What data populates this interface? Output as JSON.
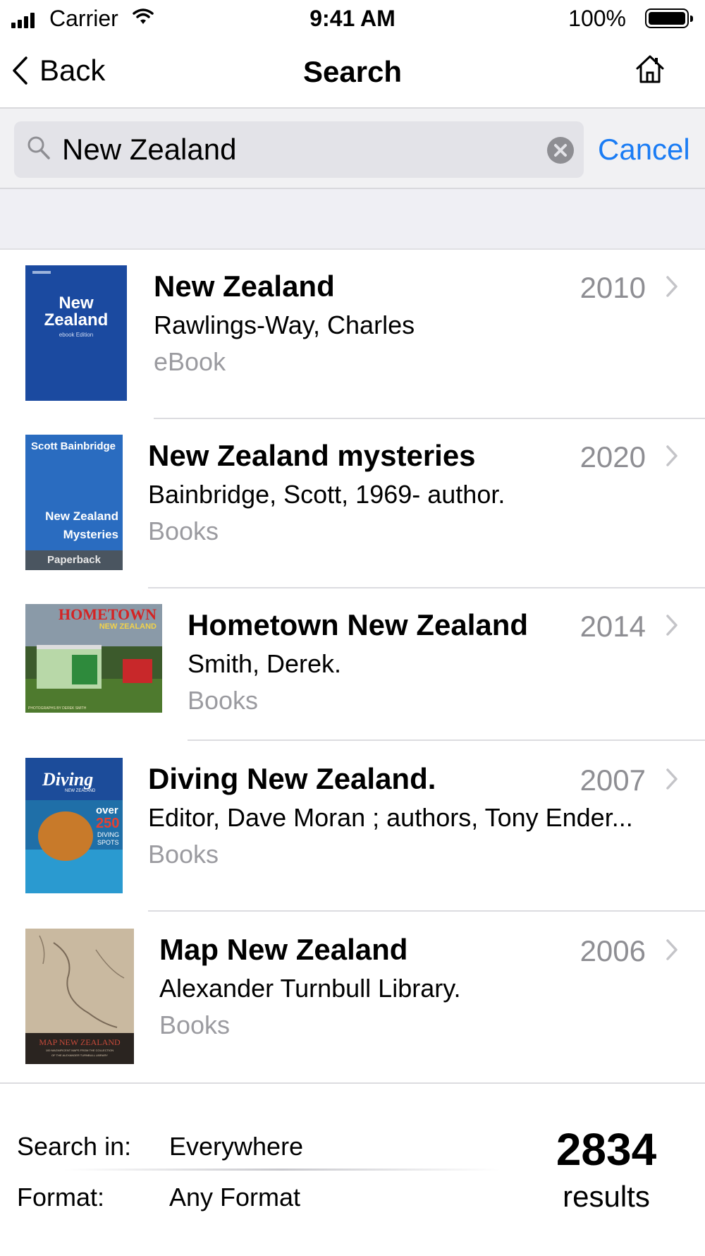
{
  "status": {
    "carrier": "Carrier",
    "time": "9:41 AM",
    "battery": "100%"
  },
  "nav": {
    "back_label": "Back",
    "title": "Search"
  },
  "search": {
    "query": "New Zealand",
    "cancel_label": "Cancel"
  },
  "results": [
    {
      "title": "New Zealand",
      "author": "Rawlings-Way, Charles",
      "format": "eBook",
      "year": "2010",
      "cover_text": [
        "New",
        "Zealand",
        "ebook Edition"
      ]
    },
    {
      "title": "New Zealand mysteries",
      "author": "Bainbridge, Scott, 1969- author.",
      "format": "Books",
      "year": "2020",
      "cover_text": [
        "Scott Bainbridge",
        "New Zealand",
        "Mysteries",
        "Paperback"
      ]
    },
    {
      "title": "Hometown New Zealand",
      "author": "Smith, Derek.",
      "format": "Books",
      "year": "2014",
      "cover_text": [
        "HOMETOWN",
        "NEW ZEALAND",
        "PHOTOGRAPHS BY DEREK SMITH"
      ]
    },
    {
      "title": "Diving New Zealand.",
      "author": "Editor, Dave Moran ; authors, Tony Ender...",
      "format": "Books",
      "year": "2007",
      "cover_text": [
        "Diving",
        "NEW ZEALAND",
        "over",
        "250",
        "DIVING",
        "SPOTS"
      ]
    },
    {
      "title": "Map New Zealand",
      "author": "Alexander Turnbull Library.",
      "format": "Books",
      "year": "2006",
      "cover_text": [
        "MAP NEW ZEALAND",
        "100 MAGNIFICENT MAPS FROM THE COLLECTION",
        "OF THE ALEXANDER TURNBULL LIBRARY"
      ]
    }
  ],
  "footer": {
    "search_in_label": "Search in:",
    "search_in_value": "Everywhere",
    "format_label": "Format:",
    "format_value": "Any Format",
    "count": "2834",
    "count_label": "results"
  }
}
